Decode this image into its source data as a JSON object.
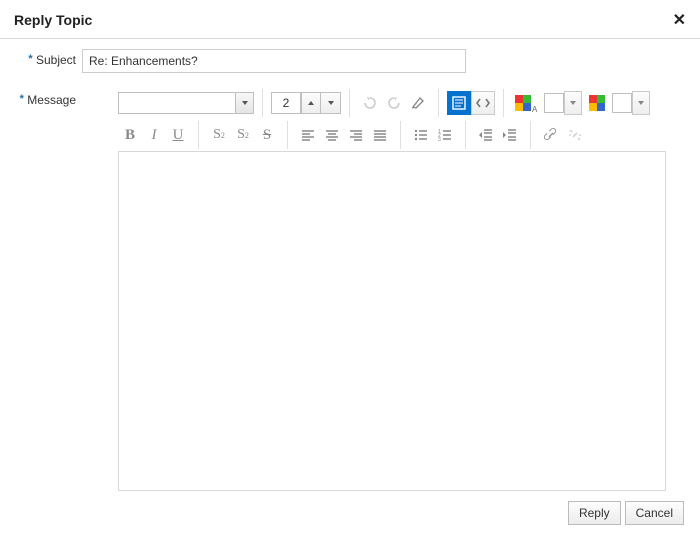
{
  "header": {
    "title": "Reply Topic",
    "close_glyph": "✕"
  },
  "form": {
    "subject_label": "Subject",
    "subject_value": "Re: Enhancements?",
    "message_label": "Message",
    "required_marker": "*"
  },
  "toolbar": {
    "font_size_value": "2"
  },
  "footer": {
    "reply_label": "Reply",
    "cancel_label": "Cancel"
  }
}
